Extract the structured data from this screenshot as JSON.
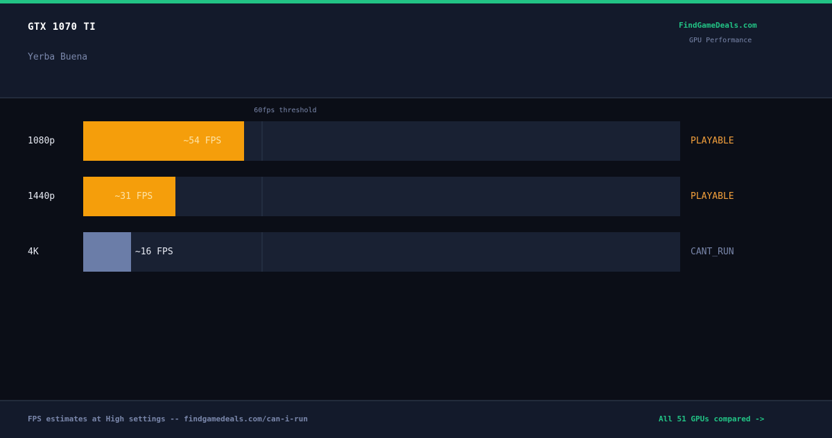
{
  "header": {
    "gpu_name": "GTX 1070 TI",
    "game_name": "Yerba Buena",
    "brand": "FindGameDeals.com",
    "brand_subtitle": "GPU Performance"
  },
  "chart_data": {
    "type": "bar",
    "orientation": "horizontal",
    "categories": [
      "1080p",
      "1440p",
      "4K"
    ],
    "values": [
      54,
      31,
      16
    ],
    "value_labels": [
      "~54 FPS",
      "~31 FPS",
      "~16 FPS"
    ],
    "statuses": [
      "PLAYABLE",
      "PLAYABLE",
      "CANT_RUN"
    ],
    "threshold": {
      "value": 60,
      "label": "60fps threshold"
    },
    "xlim": [
      0,
      200
    ],
    "grid": false,
    "colors": {
      "playable": "#f59e0b",
      "cant_run": "#6b7da8",
      "playable_text_on_bar": "#fde3a6",
      "status_playable": "#f5a13c",
      "status_cant_run": "#7a87ab",
      "label_off_bar": "#e6e9f2"
    }
  },
  "footer": {
    "note": "FPS estimates at High settings -- findgamedeals.com/can-i-run",
    "link": "All 51 GPUs compared ->"
  }
}
